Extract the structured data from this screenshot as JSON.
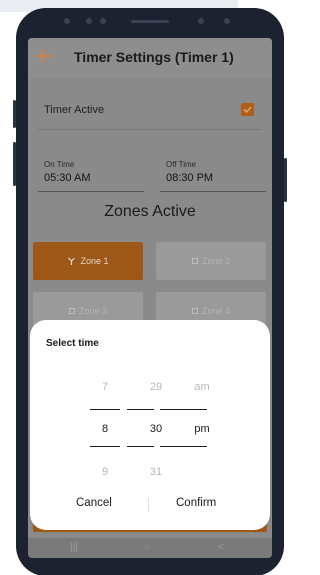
{
  "app_bar": {
    "title": "Timer Settings (Timer 1)",
    "back_icon": "arrow-left-icon",
    "accent_color": "#f08a24"
  },
  "timer_active": {
    "label": "Timer Active",
    "checked": true
  },
  "on_time": {
    "label": "On Time",
    "value": "05:30 AM"
  },
  "off_time": {
    "label": "Off Time",
    "value": "08:30 PM"
  },
  "zones": {
    "title": "Zones Active",
    "items": [
      {
        "label": "Zone 1",
        "active": true,
        "icon": "sprinkler-icon"
      },
      {
        "label": "Zone 2",
        "active": false,
        "icon": "checkbox-icon"
      },
      {
        "label": "Zone 3",
        "active": false,
        "icon": "checkbox-icon"
      },
      {
        "label": "Zone 4",
        "active": false,
        "icon": "checkbox-icon"
      }
    ]
  },
  "time_picker": {
    "title": "Select time",
    "hour": {
      "prev": "7",
      "selected": "8",
      "next": "9"
    },
    "minute": {
      "prev": "29",
      "selected": "30",
      "next": "31"
    },
    "period": {
      "prev": "am",
      "selected": "pm",
      "next": ""
    },
    "cancel_label": "Cancel",
    "confirm_label": "Confirm"
  },
  "nav_bar": {
    "icons": [
      "recents-icon",
      "home-icon",
      "back-icon"
    ],
    "glyphs": [
      "|||",
      "○",
      "<"
    ]
  }
}
